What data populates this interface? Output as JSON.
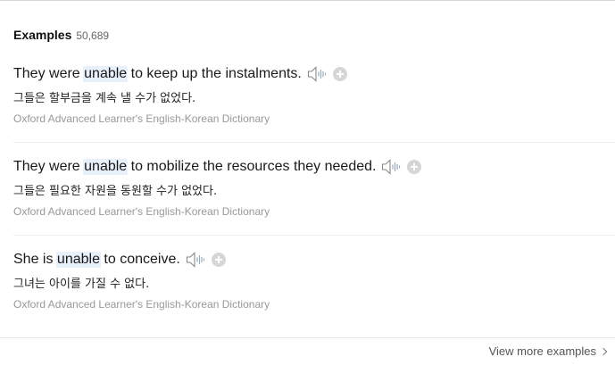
{
  "section": {
    "title": "Examples",
    "count": "50,689"
  },
  "examples": [
    {
      "before": "They were ",
      "highlight": "unable",
      "after": " to keep up the instalments.",
      "translation": "그들은 할부금을 계속 낼 수가 없었다.",
      "source": "Oxford Advanced Learner's English-Korean Dictionary"
    },
    {
      "before": "They were ",
      "highlight": "unable",
      "after": " to mobilize the resources they needed.",
      "translation": "그들은 필요한 자원을 동원할 수가 없었다.",
      "source": "Oxford Advanced Learner's English-Korean Dictionary"
    },
    {
      "before": "She is ",
      "highlight": "unable",
      "after": " to conceive.",
      "translation": "그녀는 아이를 가질 수 없다.",
      "source": "Oxford Advanced Learner's English-Korean Dictionary"
    }
  ],
  "footer": {
    "view_more_label": "View more examples"
  },
  "icons": {
    "speaker": "speaker-icon",
    "add": "add-icon",
    "chevron": "chevron-right-icon"
  },
  "colors": {
    "highlight_bg": "#e8f1fb",
    "source_text": "#999999",
    "add_button": "#d6d6d6"
  }
}
